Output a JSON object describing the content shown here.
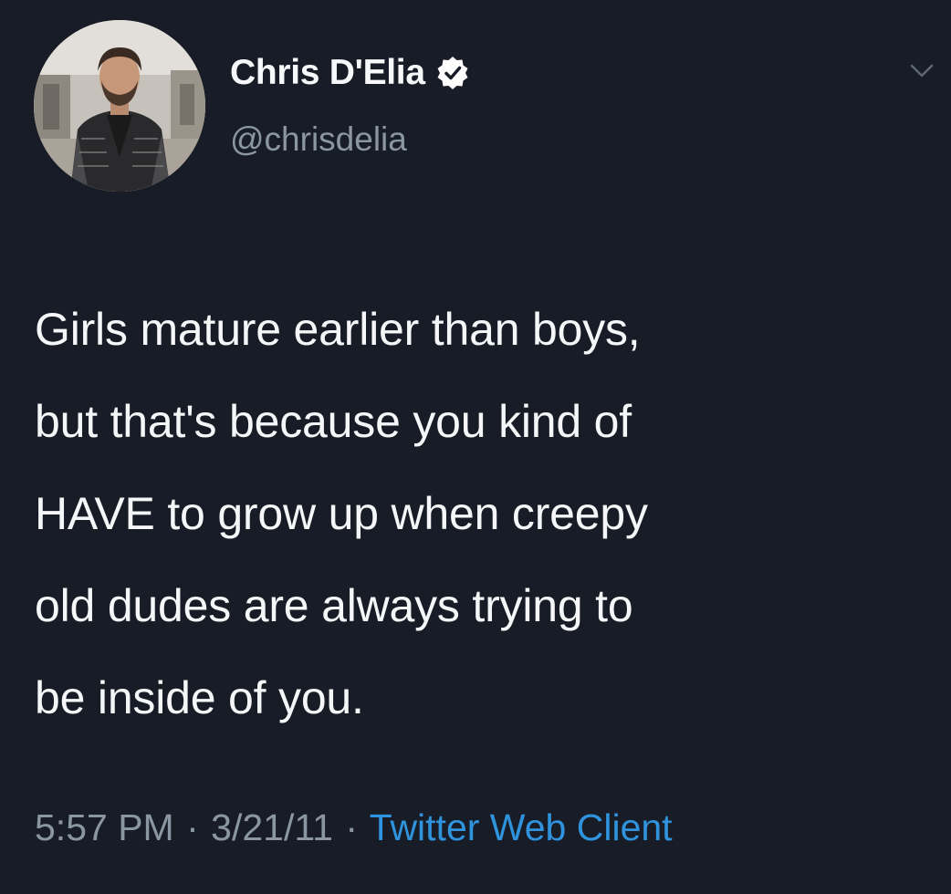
{
  "author": {
    "display_name": "Chris D'Elia",
    "handle": "@chrisdelia",
    "verified": true
  },
  "tweet": {
    "lines": [
      "Girls mature earlier than boys,",
      "but that's because you kind of",
      "HAVE to grow up when creepy",
      "old dudes are always trying to",
      "be inside of you."
    ]
  },
  "meta": {
    "time": "5:57 PM",
    "separator": "·",
    "date": "3/21/11",
    "client": "Twitter Web Client"
  },
  "icons": {
    "verified": "verified-badge-icon",
    "menu": "chevron-down-icon"
  },
  "colors": {
    "background": "#181c26",
    "text": "#f5f6f7",
    "secondary_text": "#8b96a3",
    "link": "#2f94dd"
  }
}
